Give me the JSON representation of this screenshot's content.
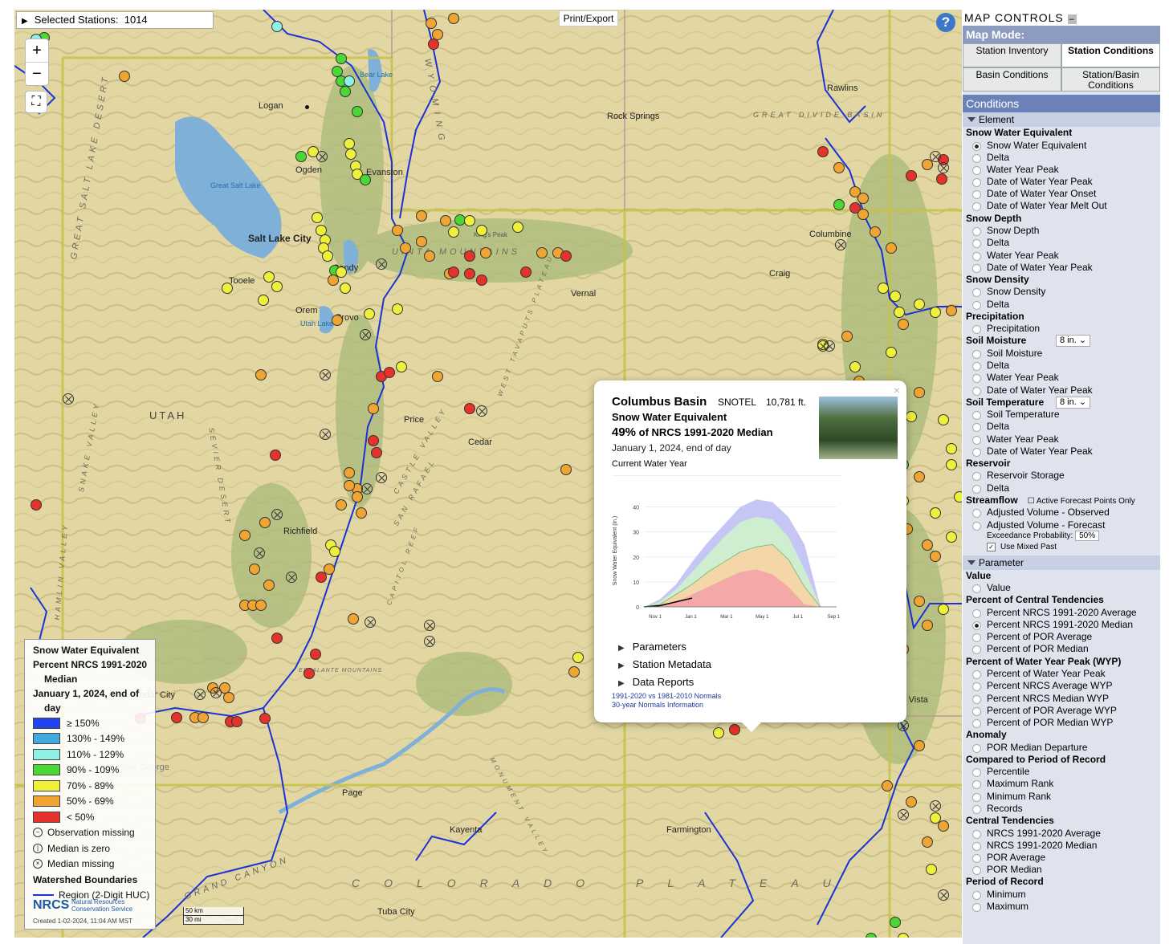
{
  "selected": {
    "label": "Selected Stations:",
    "count": "1014"
  },
  "controls": {
    "zoom_in": "+",
    "zoom_out": "−",
    "fullscreen": "⛶",
    "print": "Print/Export",
    "help": "?"
  },
  "map_labels": {
    "cities": [
      "Logan",
      "Ogden",
      "Evanston",
      "Salt Lake City",
      "Tooele",
      "Sandy",
      "Orem",
      "Provo",
      "Price",
      "Cedar",
      "Richfield",
      "Vernal",
      "Rawlins",
      "Rock Springs",
      "Columbine",
      "Craig",
      "Monte Vista",
      "Farmington",
      "Kayenta",
      "Page",
      "Tuba City",
      "Cedar City",
      "Saint George",
      "Bear Lake",
      "Utah Lake",
      "Great Salt Lake",
      "King's Peak"
    ],
    "state": "UTAH",
    "regions": [
      "GREAT SALT LAKE DESERT",
      "UINTA MOUNTAINS",
      "GREAT DIVIDE BASIN",
      "SEVIER DESERT",
      "SAN RAFAEL",
      "CASTLE VALLEY",
      "GRAND CANYON",
      "COLORADO PLATEAU",
      "WEST TAVAPUTS PLATEAU",
      "SNAKE VALLEY",
      "HAMLIN VALLEY",
      "MONUMENT VALLEY",
      "CAPITOL REEF",
      "ESCALANTE MOUNTAINS",
      "WYOMING"
    ]
  },
  "popup": {
    "close": "×",
    "name": "Columbus Basin",
    "network": "SNOTEL",
    "elevation": "10,781 ft.",
    "element": "Snow Water Equivalent",
    "pct_value": "49%",
    "pct_text": "of NRCS 1991-2020 Median",
    "date": "January 1, 2024, end of day",
    "period": "Current Water Year",
    "accordions": [
      "Parameters",
      "Station Metadata",
      "Data Reports"
    ],
    "links": [
      "1991-2020 vs 1981-2010 Normals",
      "30-year Normals Information"
    ]
  },
  "chart_data": {
    "type": "area",
    "title": "",
    "xlabel": "",
    "ylabel": "Snow Water Equivalent (in.)",
    "x_ticks": [
      "Nov 1",
      "Jan 1",
      "Mar 1",
      "May 1",
      "Jul 1",
      "Sep 1"
    ],
    "y_ticks": [
      0,
      10,
      20,
      30,
      40
    ],
    "ylim": [
      0,
      45
    ],
    "x": [
      "Oct 1",
      "Nov 1",
      "Dec 1",
      "Jan 1",
      "Feb 1",
      "Mar 1",
      "Apr 1",
      "Apr 15",
      "May 1",
      "May 15",
      "Jun 1",
      "Jun 15",
      "Jul 1"
    ],
    "series": [
      {
        "name": "max",
        "values": [
          0,
          3,
          9,
          18,
          26,
          33,
          40,
          43,
          42,
          36,
          25,
          0,
          0
        ]
      },
      {
        "name": "90th",
        "values": [
          0,
          2,
          7,
          14,
          21,
          28,
          34,
          36,
          35,
          28,
          15,
          0,
          0
        ]
      },
      {
        "name": "median",
        "values": [
          0,
          1,
          5,
          9,
          14,
          18,
          22,
          24,
          25,
          19,
          8,
          0,
          0
        ]
      },
      {
        "name": "10th",
        "values": [
          0,
          0.5,
          2,
          5,
          8,
          11,
          14,
          15,
          13,
          8,
          1,
          0,
          0
        ]
      },
      {
        "name": "current",
        "values": [
          0,
          0.5,
          2,
          3.5
        ]
      }
    ]
  },
  "legend": {
    "title_lines": [
      "Snow Water Equivalent",
      "Percent NRCS 1991-2020",
      "Median",
      "January 1, 2024, end of",
      "day"
    ],
    "classes": [
      {
        "label": "≥ 150%",
        "color": "#1f44f0"
      },
      {
        "label": "130% - 149%",
        "color": "#3fa9de"
      },
      {
        "label": "110% - 129%",
        "color": "#8ff0e3"
      },
      {
        "label": "90% - 109%",
        "color": "#4cd834"
      },
      {
        "label": "70% - 89%",
        "color": "#eef03a"
      },
      {
        "label": "50% - 69%",
        "color": "#f0a532"
      },
      {
        "label": "< 50%",
        "color": "#e5322c"
      }
    ],
    "symbols": [
      "Observation missing",
      "Median is zero",
      "Median missing"
    ],
    "watershed_title": "Watershed Boundaries",
    "huc": "Region (2-Digit HUC)",
    "nrcs_logo": "NRCS",
    "nrcs_sub": "Natural Resources Conservation Service",
    "created": "Created 1-02-2024, 11:04 AM MST"
  },
  "scalebar": {
    "km": "50 km",
    "mi": "30 mi"
  },
  "panel": {
    "title": "MAP CONTROLS",
    "collapse": "–",
    "map_mode": "Map Mode:",
    "modes": [
      {
        "label": "Station Inventory",
        "active": false
      },
      {
        "label": "Station Conditions",
        "active": true
      },
      {
        "label": "Basin Conditions",
        "active": false
      },
      {
        "label": "Station/Basin Conditions",
        "active": false
      }
    ],
    "conditions": "Conditions",
    "element_header": "Element",
    "parameter_header": "Parameter",
    "soil_depth": "8 in.",
    "soil_temp_depth": "8 in.",
    "active_forecast": "Active Forecast Points Only",
    "exceedance_label": "Exceedance Probability:",
    "exceedance_value": "50%",
    "use_mixed": "Use Mixed Past",
    "element_groups": [
      {
        "title": "Snow Water Equivalent",
        "items": [
          "Snow Water Equivalent",
          "Delta",
          "Water Year Peak",
          "Date of Water Year Peak",
          "Date of Water Year Onset",
          "Date of Water Year Melt Out"
        ]
      },
      {
        "title": "Snow Depth",
        "items": [
          "Snow Depth",
          "Delta",
          "Water Year Peak",
          "Date of Water Year Peak"
        ]
      },
      {
        "title": "Snow Density",
        "items": [
          "Snow Density",
          "Delta"
        ]
      },
      {
        "title": "Precipitation",
        "items": [
          "Precipitation"
        ]
      },
      {
        "title": "Soil Moisture",
        "items": [
          "Soil Moisture",
          "Delta",
          "Water Year Peak",
          "Date of Water Year Peak"
        ]
      },
      {
        "title": "Soil Temperature",
        "items": [
          "Soil Temperature",
          "Delta",
          "Water Year Peak",
          "Date of Water Year Peak"
        ]
      },
      {
        "title": "Reservoir",
        "items": [
          "Reservoir Storage",
          "Delta"
        ]
      },
      {
        "title": "Streamflow",
        "items": [
          "Adjusted Volume - Observed",
          "Adjusted Volume - Forecast"
        ]
      }
    ],
    "parameter_groups": [
      {
        "title": "Value",
        "items": [
          "Value"
        ]
      },
      {
        "title": "Percent of Central Tendencies",
        "items": [
          "Percent NRCS 1991-2020 Average",
          "Percent NRCS 1991-2020 Median",
          "Percent of POR Average",
          "Percent of POR Median"
        ]
      },
      {
        "title": "Percent of Water Year Peak (WYP)",
        "items": [
          "Percent of Water Year Peak",
          "Percent NRCS Average WYP",
          "Percent NRCS Median WYP",
          "Percent of POR Average WYP",
          "Percent of POR Median WYP"
        ]
      },
      {
        "title": "Anomaly",
        "items": [
          "POR Median Departure"
        ]
      },
      {
        "title": "Compared to Period of Record",
        "items": [
          "Percentile",
          "Maximum Rank",
          "Minimum Rank",
          "Records"
        ]
      },
      {
        "title": "Central Tendencies",
        "items": [
          "NRCS 1991-2020 Average",
          "NRCS 1991-2020 Median",
          "POR Average",
          "POR Median"
        ]
      },
      {
        "title": "Period of Record",
        "items": [
          "Minimum",
          "Maximum"
        ]
      }
    ]
  }
}
